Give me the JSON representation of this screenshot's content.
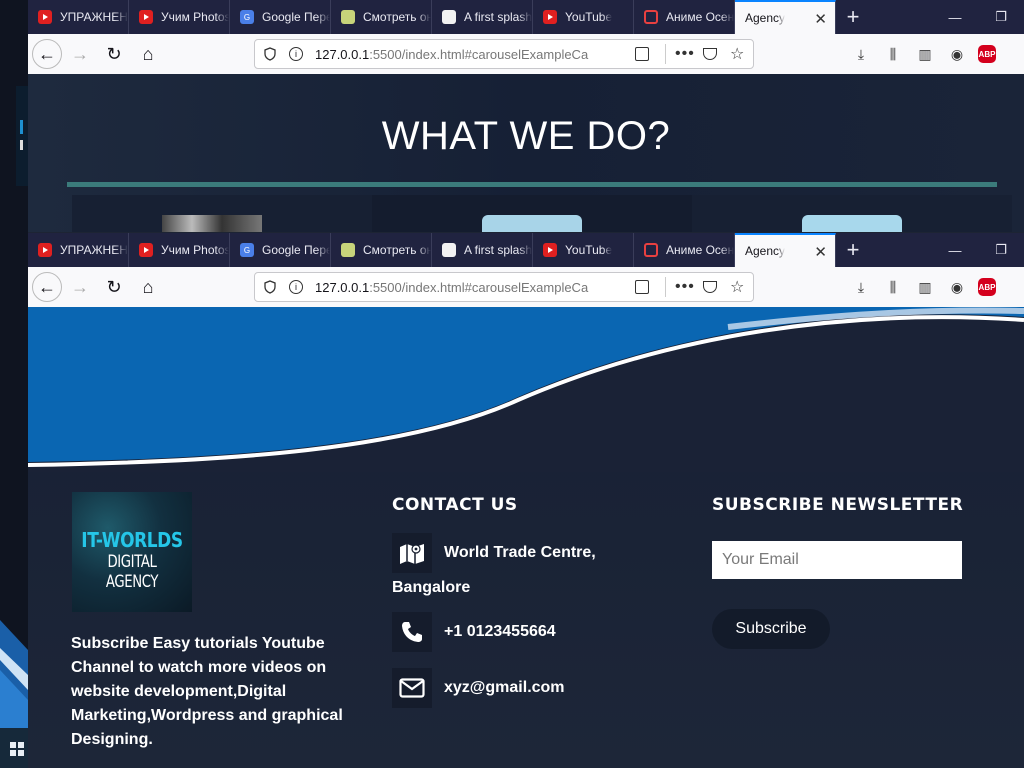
{
  "tabs": [
    {
      "label": "УПРАЖНЕНИЯ",
      "icon": "youtube-icon"
    },
    {
      "label": "Учим Photoshop",
      "icon": "youtube-icon"
    },
    {
      "label": "Google Переводчик",
      "icon": "google-translate-icon"
    },
    {
      "label": "Смотреть онлайн",
      "icon": "smotret-icon"
    },
    {
      "label": "A first splash",
      "icon": "splash-icon"
    },
    {
      "label": "YouTube",
      "icon": "youtube-icon"
    },
    {
      "label": "Аниме Осень",
      "icon": "anime-icon"
    }
  ],
  "active_tab": {
    "label": "Agency"
  },
  "address": {
    "host": "127.0.0.1",
    "path": ":5500/index.html#carouselExampleCa"
  },
  "section": {
    "title": "WHAT WE DO?"
  },
  "logo": {
    "line1": "IT-WORLDS",
    "line2": "DIGITAL AGENCY"
  },
  "about": {
    "text": "Subscribe Easy tutorials Youtube Channel to watch more videos on website development,Digital Marketing,Wordpress and graphical Designing."
  },
  "contact": {
    "title": "CONTACT US",
    "address": "World Trade Centre, Bangalore",
    "phone": "+1 0123455664",
    "email": "xyz@gmail.com"
  },
  "newsletter": {
    "title": "SUBSCRIBE NEWSLETTER",
    "placeholder": "Your Email",
    "button": "Subscribe"
  },
  "colors": {
    "tabbar": "#202340",
    "accent": "#0a84ff",
    "hero_blue": "#0a66b2",
    "divider": "#3b7b7b",
    "footer_bg": "#1d2638"
  }
}
